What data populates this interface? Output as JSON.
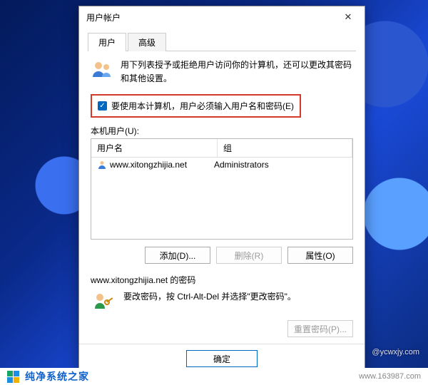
{
  "window": {
    "title": "用户帐户",
    "tabs": {
      "users": "用户",
      "advanced": "高级"
    },
    "intro": "用下列表授予或拒绝用户访问你的计算机，还可以更改其密码和其他设置。",
    "require_login_label": "要使用本计算机，用户必须输入用户名和密码(E)",
    "local_users_label": "本机用户(U):",
    "columns": {
      "name": "用户名",
      "group": "组"
    },
    "rows": [
      {
        "name": "www.xitongzhijia.net",
        "group": "Administrators"
      }
    ],
    "buttons": {
      "add": "添加(D)...",
      "remove": "删除(R)",
      "props": "属性(O)"
    },
    "password_section": {
      "header": "www.xitongzhijia.net 的密码",
      "text": "要改密码，按 Ctrl-Alt-Del 并选择\"更改密码\"。",
      "reset": "重置密码(P)..."
    },
    "ok": "确定"
  },
  "desktop": {
    "signature": "@ycwxjy.com"
  },
  "banner": {
    "text": "纯净系统之家",
    "url": "www.163987.com"
  }
}
